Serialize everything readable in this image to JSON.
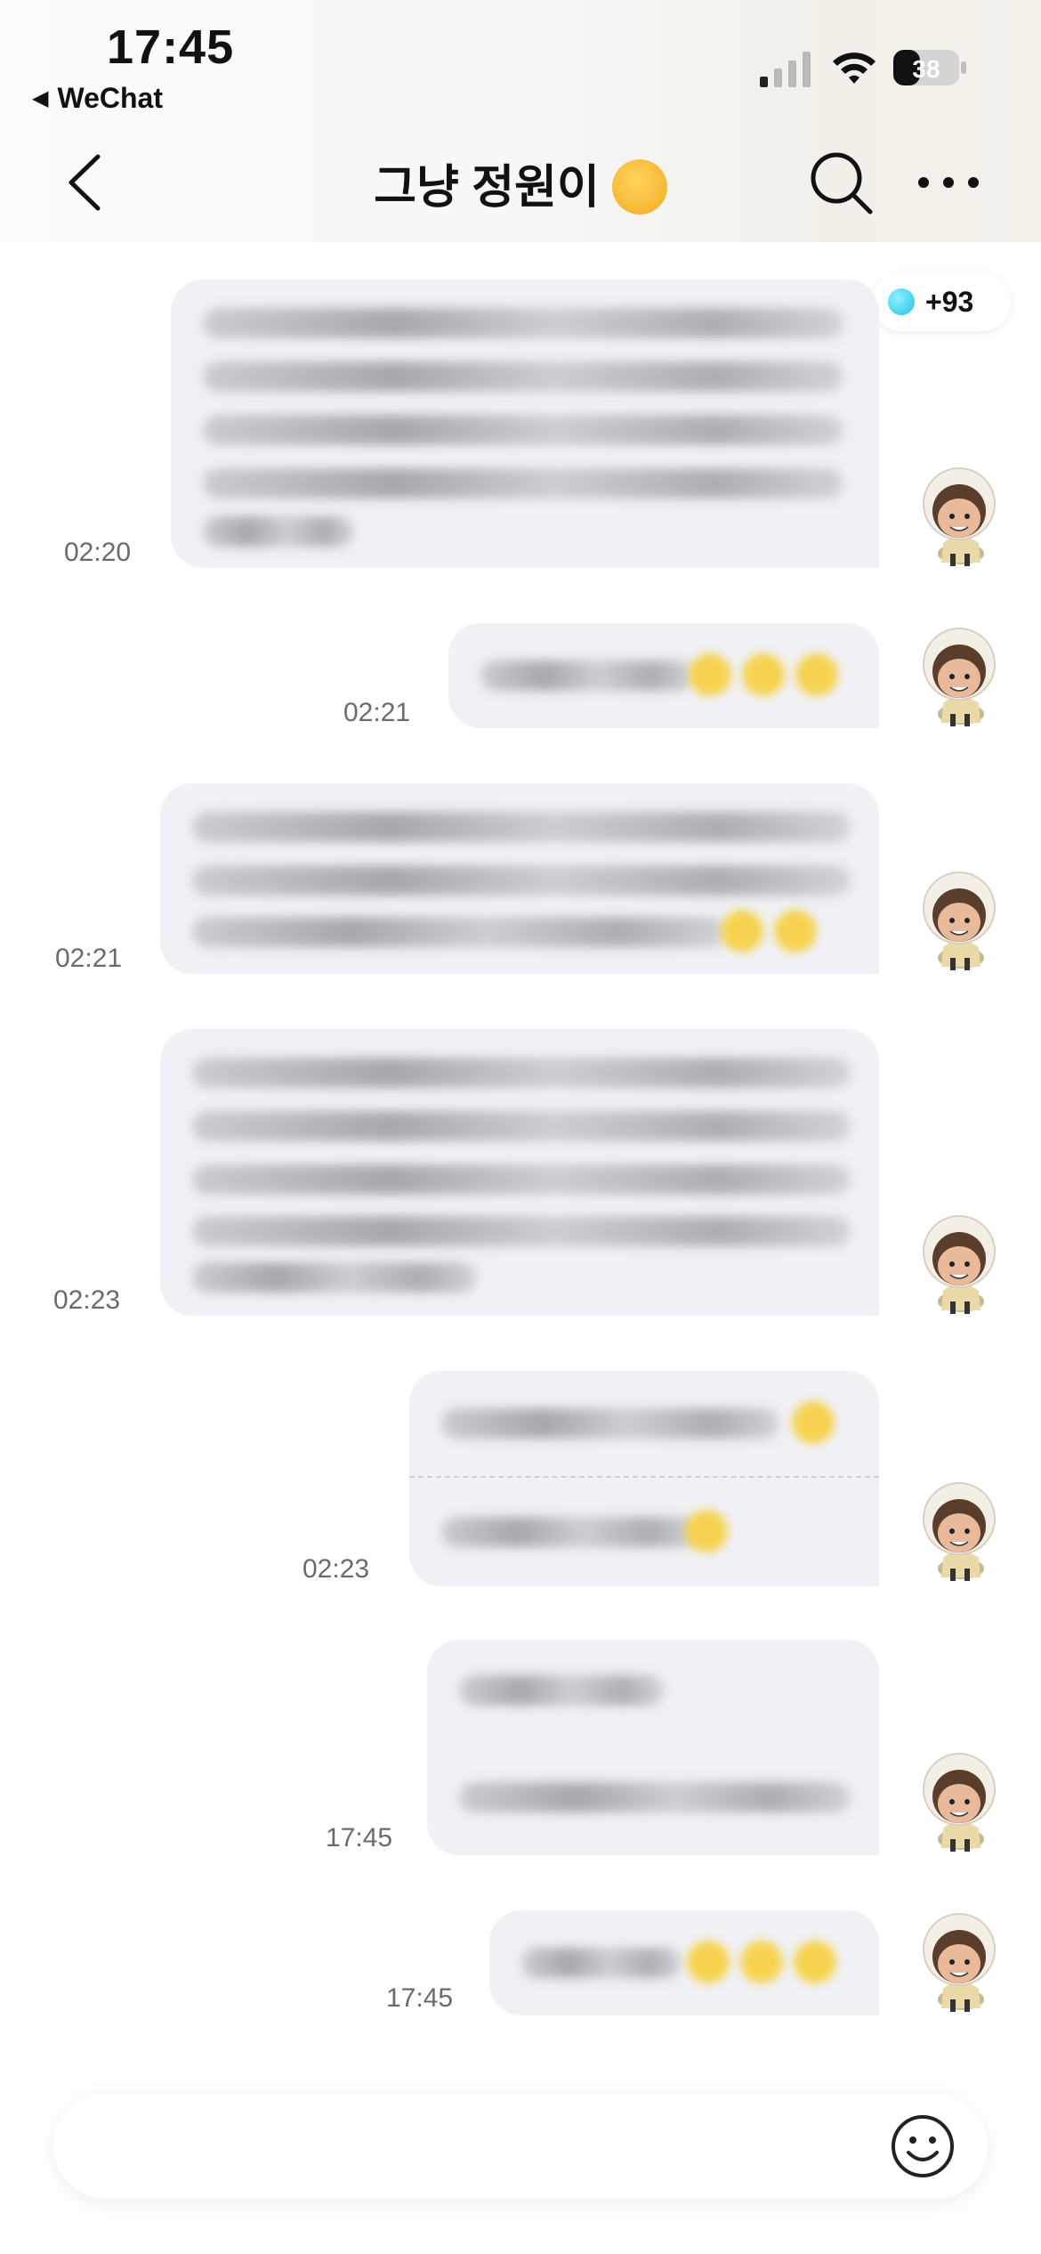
{
  "status_bar": {
    "time": "17:45",
    "back_app_label": "WeChat",
    "battery_level": "38"
  },
  "header": {
    "title": "그냥 정원이",
    "title_emoji": "smiling-face-with-hearts-icon"
  },
  "badge": {
    "label": "+93"
  },
  "messages": [
    {
      "timestamp": "02:20",
      "content": "blurred"
    },
    {
      "timestamp": "02:21",
      "content": "blurred"
    },
    {
      "timestamp": "02:21",
      "content": "blurred"
    },
    {
      "timestamp": "02:23",
      "content": "blurred"
    },
    {
      "timestamp": "02:23",
      "content": "blurred"
    },
    {
      "timestamp": "17:45",
      "content": "blurred"
    },
    {
      "timestamp": "17:45",
      "content": "blurred"
    }
  ],
  "input": {
    "placeholder": "",
    "value": ""
  },
  "colors": {
    "bubble": "#f0f1f5",
    "timestamp": "#6b6b6b",
    "background": "#ffffff"
  }
}
